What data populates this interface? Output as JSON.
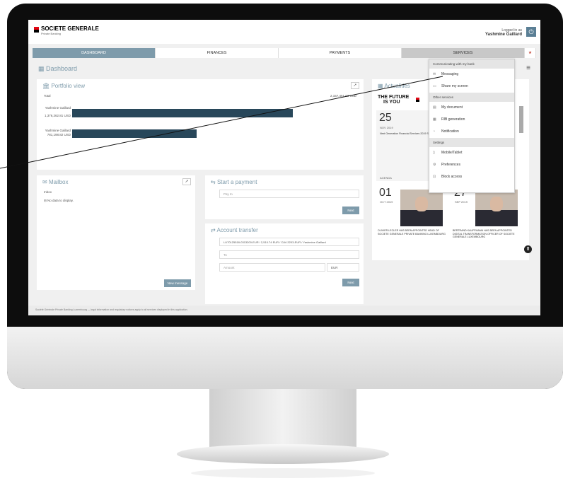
{
  "header": {
    "brand": "SOCIETE GENERALE",
    "brand_sub": "Private Banking",
    "logged_label": "Logged in as",
    "user_name": "Yashmine Gaillard"
  },
  "nav": {
    "tabs": [
      "DASHBOARD",
      "FINANCES",
      "PAYMENTS",
      "SERVICES"
    ]
  },
  "page": {
    "title": "Dashboard"
  },
  "portfolio": {
    "title": "Portfolio view",
    "total_label": "Total",
    "total_value": "2,157,461.63 USD",
    "rows": [
      {
        "name": "Yashmine Gaillard",
        "value": "1,376,262.81 USD",
        "fraction": 0.78
      },
      {
        "name": "Yashmine Gaillard",
        "value": "781,198.82 USD",
        "fraction": 0.44
      }
    ]
  },
  "actualities": {
    "title": "Actualities",
    "banner_line1": "THE FUTURE",
    "banner_line2": "IS YOU",
    "banner_brand": "SOCIETE GENERALE",
    "card1_day": "25",
    "card1_month": "NOV 2019",
    "card1_text": "Next Generation Financial Services 2019 Summit",
    "card2_day": "01",
    "card2_month": "OCT 2019",
    "card2_text": "OLIVIER LECLER HAS BEEN APPOINTED HEAD OF SOCIETE GENERALE PRIVATE BANKING LUXEMBOURG",
    "card3_day": "27",
    "card3_month": "SEP 2019",
    "card3_text": "BERTRAND KAUFFMANN HAS BEEN APPOINTED DIGITAL TRANSFORMATION OFFICER OF SOCIETE GENERALE LUXEMBOURG",
    "tag": "AGENDA"
  },
  "mailbox": {
    "title": "Mailbox",
    "inbox": "Inbox",
    "empty": "No data to display.",
    "new_message": "New message"
  },
  "payment": {
    "title": "Start a payment",
    "pay_to": "Pay to",
    "next": "Next"
  },
  "transfer": {
    "title": "Account transfer",
    "from": "LU70125518-0313200-EUR / 2,510.74 EUR / CAV-3203-EUR / Yashmine Gaillard",
    "to": "To",
    "amount": "Amount",
    "currency": "EUR",
    "next": "Next"
  },
  "dropdown": {
    "sec1": "Communicating with my bank",
    "items1": [
      "Messaging",
      "Share my screen"
    ],
    "sec2": "Other services",
    "items2": [
      "My document",
      "RIB generation",
      "Notification"
    ],
    "sec3": "Settings",
    "items3": [
      "Mobile/Tablet",
      "Preferences",
      "Block access"
    ]
  },
  "footer": "Société Générale Private Banking Luxembourg — legal information and regulatory notices apply to all services displayed in this application."
}
